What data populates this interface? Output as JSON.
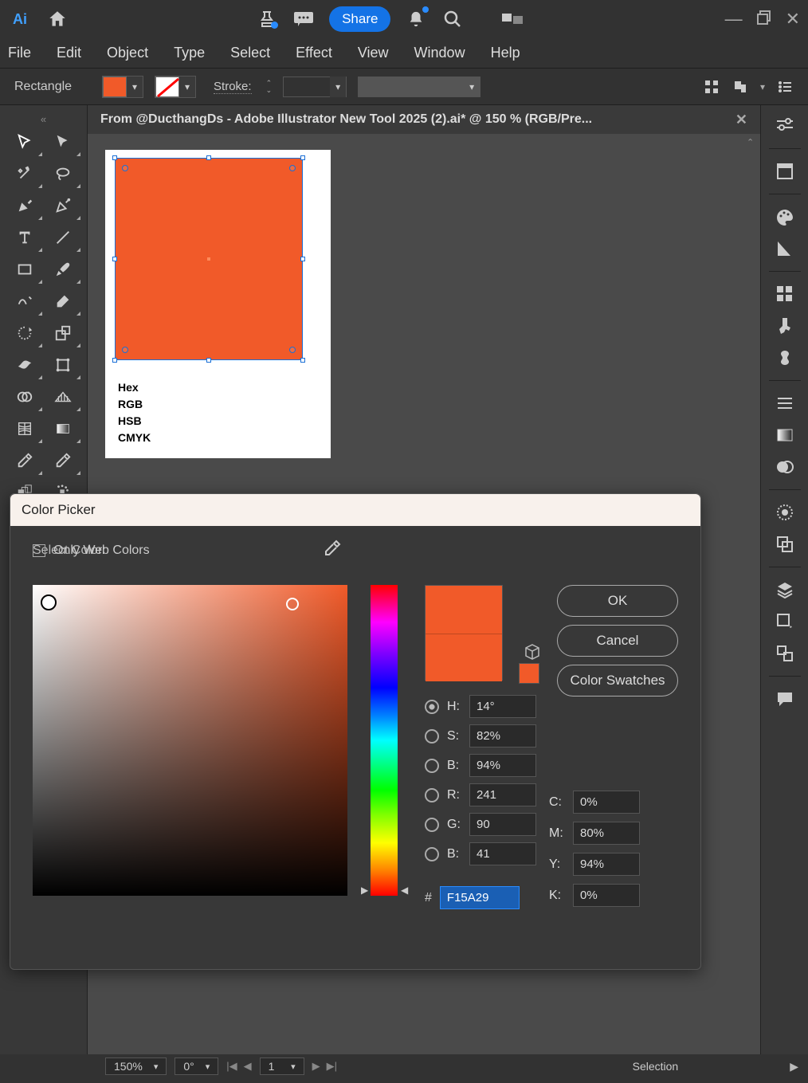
{
  "title_bar": {
    "logo_text": "Ai",
    "share_label": "Share"
  },
  "menubar": [
    "File",
    "Edit",
    "Object",
    "Type",
    "Select",
    "Effect",
    "View",
    "Window",
    "Help"
  ],
  "controlbar": {
    "shape": "Rectangle",
    "fill_color": "#f15a29",
    "stroke_label": "Stroke:"
  },
  "document_tab": {
    "title": "From @DucthangDs - Adobe Illustrator New Tool 2025 (2).ai* @ 150 % (RGB/Pre..."
  },
  "artboard": {
    "rect_color": "#f15a29",
    "labels": [
      "Hex",
      "RGB",
      "HSB",
      "CMYK"
    ]
  },
  "color_picker": {
    "title": "Color Picker",
    "select_label": "Select Color:",
    "ok": "OK",
    "cancel": "Cancel",
    "swatches": "Color Swatches",
    "hsb": {
      "H_label": "H:",
      "H_val": "14°",
      "S_label": "S:",
      "S_val": "82%",
      "B_label": "B:",
      "B_val": "94%"
    },
    "rgb": {
      "R_label": "R:",
      "R_val": "241",
      "G_label": "G:",
      "G_val": "90",
      "B_label": "B:",
      "B_val": "41"
    },
    "cmyk": {
      "C_label": "C:",
      "C_val": "0%",
      "M_label": "M:",
      "M_val": "80%",
      "Y_label": "Y:",
      "Y_val": "94%",
      "K_label": "K:",
      "K_val": "0%"
    },
    "hex_prefix": "#",
    "hex_val": "F15A29",
    "web_colors": "Only Web Colors"
  },
  "statusbar": {
    "zoom": "150%",
    "rotation": "0°",
    "page": "1",
    "mode": "Selection"
  }
}
